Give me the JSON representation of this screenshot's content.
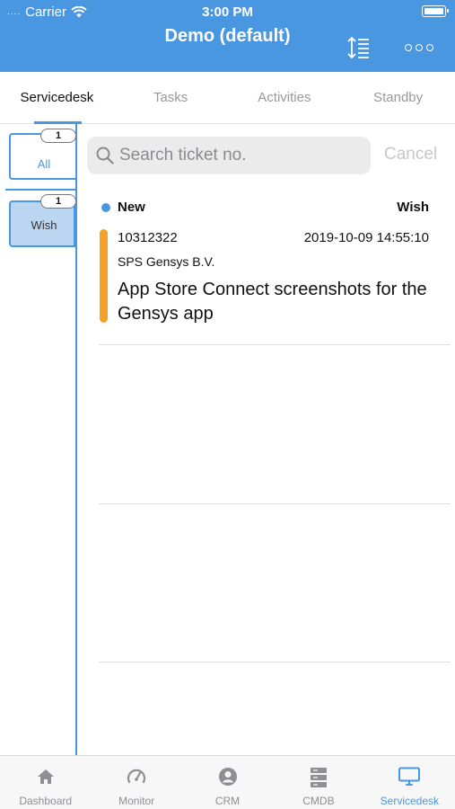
{
  "status_bar": {
    "signal_dots": "....",
    "carrier": "Carrier",
    "time": "3:00 PM"
  },
  "nav": {
    "title": "Demo (default)",
    "sort_icon": "sort-lines-icon",
    "more_icon": "ellipsis-icon"
  },
  "tabs": [
    {
      "label": "Servicedesk",
      "active": true
    },
    {
      "label": "Tasks",
      "active": false
    },
    {
      "label": "Activities",
      "active": false
    },
    {
      "label": "Standby",
      "active": false
    }
  ],
  "filters": [
    {
      "label": "All",
      "count": "1",
      "selected": true
    },
    {
      "label": "Wish",
      "count": "1",
      "selected": false
    }
  ],
  "search": {
    "placeholder": "Search ticket no.",
    "value": "",
    "cancel_label": "Cancel"
  },
  "tickets": [
    {
      "status": "New",
      "type": "Wish",
      "number": "10312322",
      "datetime": "2019-10-09 14:55:10",
      "company": "SPS Gensys B.V.",
      "subject": "App Store Connect screenshots for the Gensys app"
    }
  ],
  "tabbar": [
    {
      "label": "Dashboard",
      "icon": "home-icon",
      "active": false
    },
    {
      "label": "Monitor",
      "icon": "speedometer-icon",
      "active": false
    },
    {
      "label": "CRM",
      "icon": "user-circle-icon",
      "active": false
    },
    {
      "label": "CMDB",
      "icon": "server-stack-icon",
      "active": false
    },
    {
      "label": "Servicedesk",
      "icon": "monitor-icon",
      "active": true
    }
  ],
  "colors": {
    "accent": "#4a97e1",
    "priority": "#f5a026",
    "filter_selected_bg": "#bcd6f2"
  }
}
